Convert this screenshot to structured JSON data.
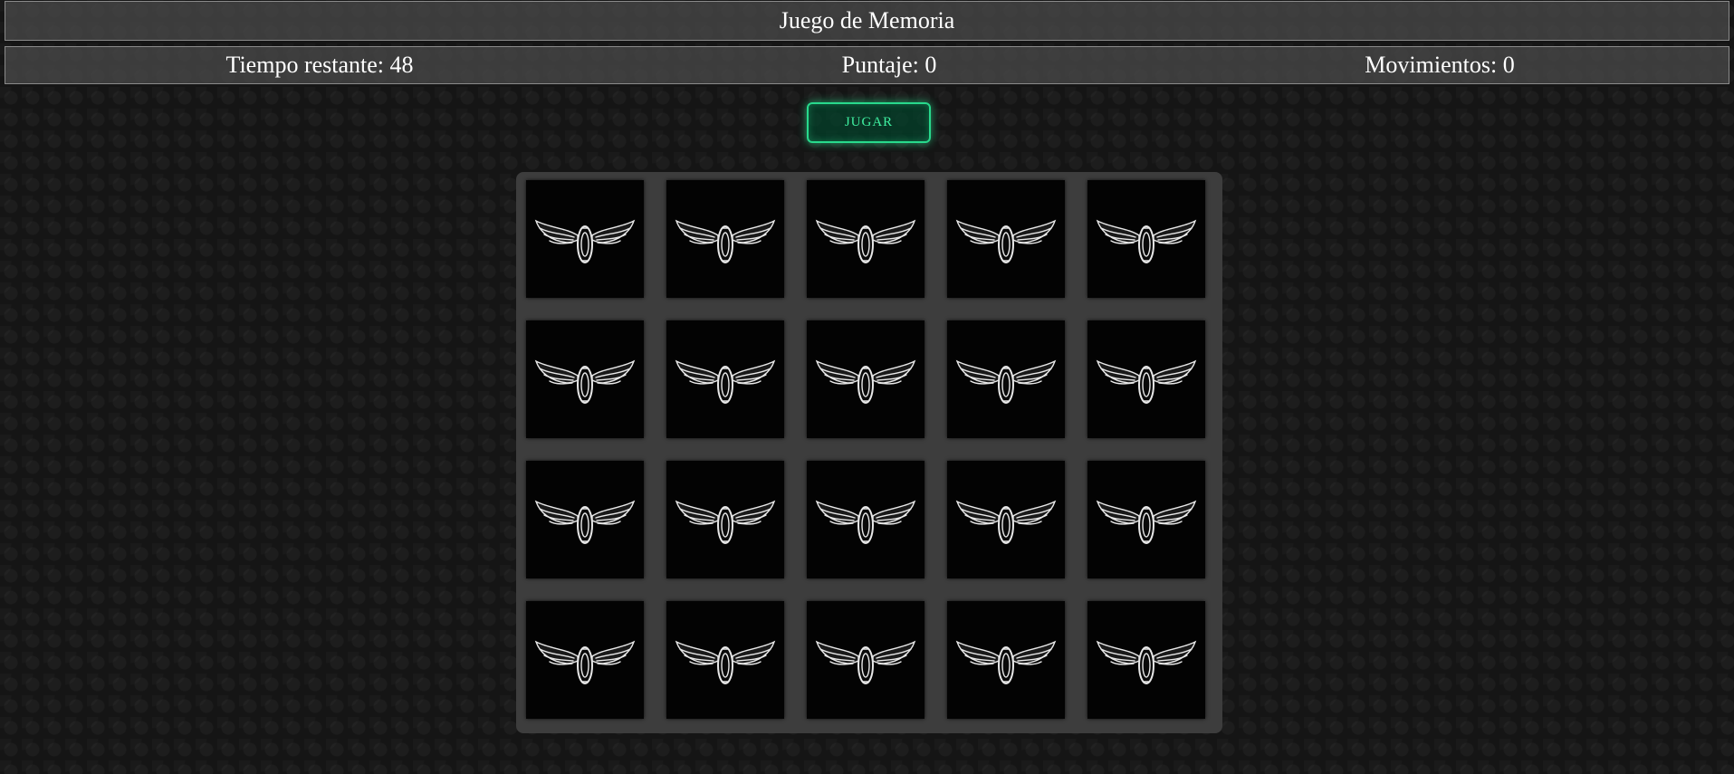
{
  "header": {
    "title": "Juego de Memoria"
  },
  "stats": {
    "time_label": "Tiempo restante: ",
    "time_value": "48",
    "score_label": "Puntaje: ",
    "score_value": "0",
    "moves_label": "Movimientos: ",
    "moves_value": "0"
  },
  "controls": {
    "play_label": "JUGAR"
  },
  "board": {
    "rows": 4,
    "columns": 5,
    "card_back_icon": "winged-wheel-icon",
    "cards_face_down": 20
  },
  "colors": {
    "accent": "#28d98c",
    "card_back": "#030303",
    "board": "#3d3d3d"
  }
}
